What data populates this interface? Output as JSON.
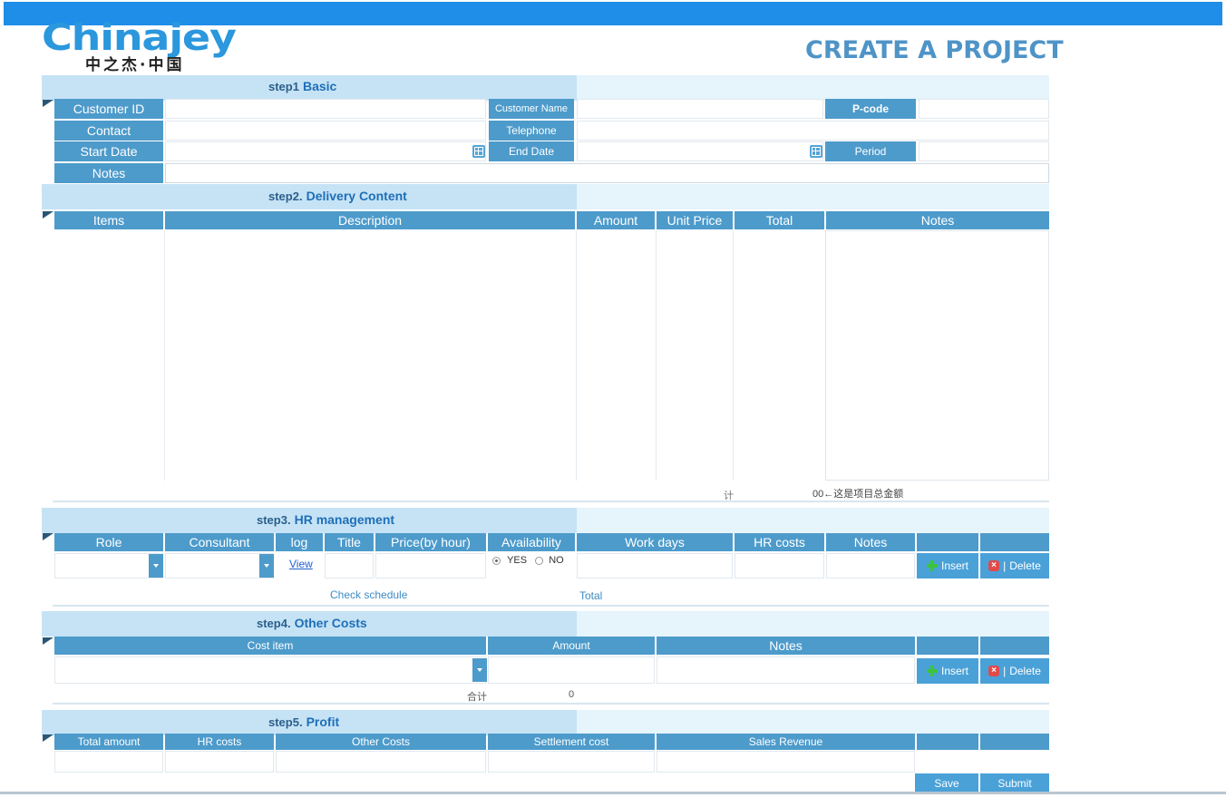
{
  "brand": {
    "logo_text": "Chinajey",
    "logo_sub": "中之杰·中国"
  },
  "page": {
    "title": "CREATE A PROJECT"
  },
  "step1": {
    "num": "step1",
    "title": "Basic",
    "labels": {
      "customer_id": "Customer ID",
      "customer_name": "Customer Name",
      "pcode": "P-code",
      "contact": "Contact",
      "telephone": "Telephone",
      "start_date": "Start Date",
      "end_date": "End Date",
      "period": "Period",
      "notes": "Notes"
    }
  },
  "step2": {
    "num": "step2.",
    "title": "Delivery Content",
    "columns": [
      "Items",
      "Description",
      "Amount",
      "Unit Price",
      "Total",
      "Notes"
    ],
    "total_row": {
      "label": "计",
      "value": "00←这是项目总金额"
    }
  },
  "step3": {
    "num": "step3.",
    "title": "HR management",
    "columns": [
      "Role",
      "Consultant",
      "log",
      "Title",
      "Price(by hour)",
      "Availability",
      "Work days",
      "HR costs",
      "Notes"
    ],
    "view_link": "View",
    "yes_label": "YES",
    "no_label": "NO",
    "insert_label": "Insert",
    "delete_label": "Delete",
    "check_schedule": "Check schedule",
    "total_label": "Total"
  },
  "step4": {
    "num": "step4.",
    "title": "Other Costs",
    "columns": [
      "Cost item",
      "Amount",
      "Notes"
    ],
    "insert_label": "Insert",
    "delete_label": "Delete",
    "sum_label": "合计",
    "sum_value": "0"
  },
  "step5": {
    "num": "step5.",
    "title": "Profit",
    "columns": [
      "Total amount",
      "HR costs",
      "Other Costs",
      "Settlement cost",
      "Sales Revenue"
    ]
  },
  "actions": {
    "save": "Save",
    "submit": "Submit"
  },
  "colors": {
    "topbar": "#1e8ee8",
    "header": "#4d9bcb",
    "band_light": "#c6e3f5",
    "title": "#4f94c7"
  }
}
